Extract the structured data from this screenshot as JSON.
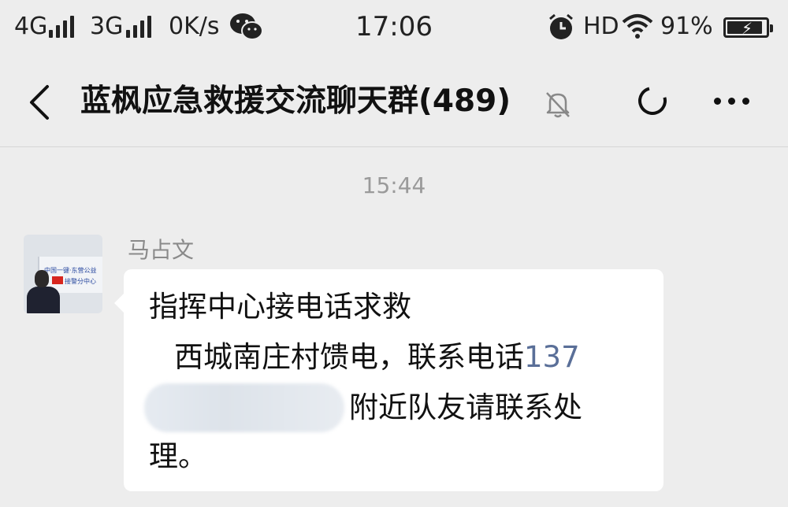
{
  "status_bar": {
    "network1": "4G",
    "network2": "3G",
    "speed": "0K/s",
    "time": "17:06",
    "hd": "HD",
    "battery": "91%",
    "battery_level": 0.91
  },
  "header": {
    "title": "蓝枫应急救援交流聊天群(489)"
  },
  "chat": {
    "timestamp": "15:44",
    "avatar_text": {
      "line1": "中国一键·东营公益",
      "line2": "接警分中心"
    },
    "message": {
      "sender": "马占文",
      "line1": "指挥中心接电话求救",
      "line2": "西城南庄村馈电，联系电话",
      "phone": "137",
      "line3": "附近队友请联系处",
      "line4": "理。"
    }
  },
  "colors": {
    "background": "#ededed",
    "bubble": "#ffffff",
    "link": "#5a6f98",
    "muted_text": "#9a9a9a"
  },
  "icons": [
    "wechat-icon",
    "alarm-icon",
    "wifi-icon",
    "battery-icon",
    "back-icon",
    "mute-bell-icon",
    "refresh-circle-icon",
    "more-icon"
  ]
}
